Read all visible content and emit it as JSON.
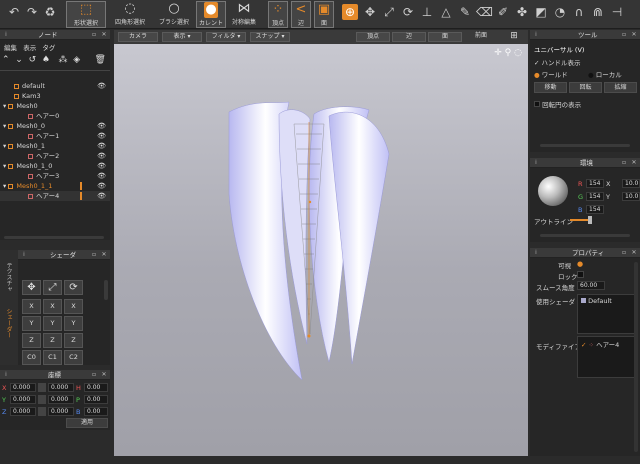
{
  "toolbar": {
    "shape_select": "形状選択",
    "mesh_select": "四角形選択",
    "brush_select": "ブラシ選択",
    "current": "カレント",
    "symmetry": "対称編集",
    "vertex": "頂点",
    "edge": "辺",
    "face": "面"
  },
  "node_panel": {
    "title": "ノード",
    "menu": [
      "編集",
      "表示",
      "タグ"
    ],
    "items": [
      {
        "label": "default",
        "eye": "👁"
      },
      {
        "label": "Kam3",
        "eye": ""
      },
      {
        "label": "Mesh0",
        "eye": ""
      },
      {
        "label": "ヘアー0",
        "eye": ""
      },
      {
        "label": "Mesh0_0",
        "eye": "👁"
      },
      {
        "label": "ヘアー1",
        "eye": "👁"
      },
      {
        "label": "Mesh0_1",
        "eye": "👁"
      },
      {
        "label": "ヘアー2",
        "eye": "👁"
      },
      {
        "label": "Mesh0_1_0",
        "eye": "👁"
      },
      {
        "label": "ヘアー3",
        "eye": "👁"
      },
      {
        "label": "Mesh0_1_1",
        "eye": "👁"
      },
      {
        "label": "ヘアー4",
        "eye": "👁"
      }
    ]
  },
  "shader_panel": {
    "title": "シェーダ",
    "side_tabs": [
      "テクスチャ",
      "シェーダー"
    ],
    "buttons": [
      "X",
      "X",
      "Y",
      "Y",
      "Z",
      "Z",
      "C0",
      "C1",
      "C2"
    ]
  },
  "coord_panel": {
    "title": "座標",
    "rows": [
      {
        "a": "X",
        "av": "0.000",
        "b": "H",
        "bv": "0.00"
      },
      {
        "a": "Y",
        "av": "0.000",
        "b": "P",
        "bv": "0.00"
      },
      {
        "a": "Z",
        "av": "0.000",
        "b": "B",
        "bv": "0.00"
      }
    ],
    "apply": "適用"
  },
  "viewport_bar": {
    "camera": "カメラ",
    "display": "表示",
    "filter": "フィルタ",
    "snap": "スナップ",
    "vertex": "頂点",
    "edge": "辺",
    "face": "面",
    "front": "前面"
  },
  "tool_panel": {
    "title": "ツール",
    "subtitle": "ユニバーサル (V)",
    "handle": "ハンドル表示",
    "world": "ワールド",
    "local": "ローカル",
    "move": "移動",
    "rotate": "回転",
    "scale": "拡縮",
    "show_circle": "回転円の表示"
  },
  "env_panel": {
    "title": "環境",
    "R": "154",
    "G": "154",
    "B": "154",
    "X": "10.0",
    "Y": "10.0",
    "outline": "アウトライン"
  },
  "prop_panel": {
    "title": "プロパティ",
    "visible": "可視",
    "lock": "ロック",
    "smooth_label": "スムース角度",
    "smooth_value": "60.00",
    "shader_label": "使用シェーダ",
    "shader_value": "Default",
    "modifier_label": "モディファイア",
    "modifier_value": "ヘアー4"
  },
  "colors": {
    "accent": "#e58a2a",
    "panel": "#262626",
    "hair": "#ececff"
  }
}
